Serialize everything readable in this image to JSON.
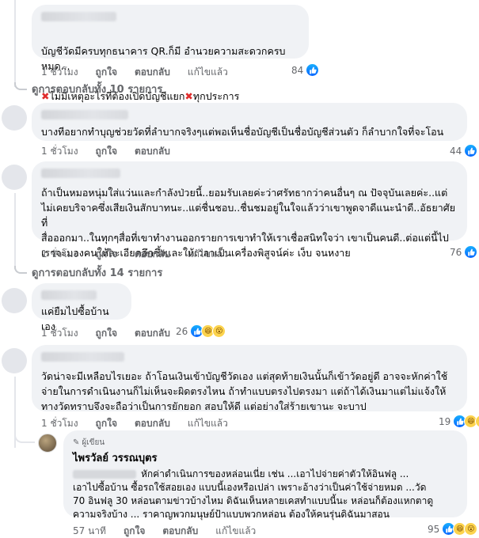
{
  "comments": [
    {
      "text_line1": "บัญชีวัดมีครบทุกธนาคาร QR.ก็มี อำนวยความสะดวกครบหมด...",
      "text_line2": "ไม่มีเหตุอะไรที่ต้องเปิดบัญชีแยก",
      "text_line2_end": "ทุกประการ",
      "time": "1 ชั่วโมง",
      "like": "ถูกใจ",
      "reply": "ตอบกลับ",
      "edited": "แก้ไขแล้ว",
      "reactions": "84",
      "thread": "ดูการตอบกลับทั้ง 10 รายการ"
    },
    {
      "text": "บางทีอยากทำบุญช่วยวัดที่ลำบากจริงๆแต่พอเห็นชื่อบัญชีเป็นชื่อบัญชีส่วนตัว ก็ลำบากใจที่จะโอน",
      "time": "1 ชั่วโมง",
      "like": "ถูกใจ",
      "reply": "ตอบกลับ",
      "reactions": "44"
    },
    {
      "text": "ถ้าเป็นหมอหนุ่มใส่แว่นและกำลังป่วยนี้..ยอมรับเลยค่ะว่าศรัทธากว่าคนอื่นๆ ณ ปัจจุบันเลยค่ะ..แต่\nไม่เคยบริจาคซึ่งเสียเงินสักบาทนะ..แต่ชื่นชอบ..ชื่นชมอยู่ในใจแล้วว่าเขาพูดจาดีแนะนำดี..อัธยาศัยที่\nสื่อออกมา..ในทุกๆสื่อที่เขาทำงานออกรายการเขาทำให้เราเชื่อสนิทใจว่า เขาเป็นคนดี..ต่อแต่นี้ไป\nเราจะมองคนให้ละเอียดลึกซึ้งและให้เวลาเป็นเครื่องพิสูจน์ค่ะ เง็บ จนหงาย",
      "time": "1 ชั่วโมง",
      "like": "ถูกใจ",
      "reply": "ตอบกลับ",
      "edited": "แก้ไขแล้ว",
      "reactions": "76",
      "thread": "ดูการตอบกลับทั้ง 14 รายการ"
    },
    {
      "text": "แค่ยืมไปซื้อบ้านเอง",
      "time": "1 ชั่วโมง",
      "like": "ถูกใจ",
      "reply": "ตอบกลับ",
      "reactions": "26"
    },
    {
      "text": "วัดน่าจะมีเหลือบไรเยอะ ถ้าโอนเงินเข้าบัญชีวัดเอง แต่สุดท้ายเงินนั้นก็เข้าวัดอยู่ดี อาจจะหักค่าใช้\nจ่ายในการดำเนินงานก็ไม่เห็นจะผิดตรงไหน ถ้าทำแบบตรงไปตรงมา แต่ถ้าได้เงินมาแต่ไม่แจ้งให้\nทางวัดทราบจึงจะถือว่าเป็นการยักยอก สอบให้ดี แต่อย่างใส่ร้ายเขานะ จะบาป",
      "time": "1 ชั่วโมง",
      "like": "ถูกใจ",
      "reply": "ตอบกลับ",
      "edited": "แก้ไขแล้ว",
      "reactions": "19"
    }
  ],
  "reply": {
    "badge": "ผู้เขียน",
    "author": "ไพรวัลย์ วรรณบุตร",
    "text": "หักค่าดำเนินการของหล่อนเนี่ย เช่น ...เอาไปจ่ายค่าตัวให้อินฟลู ...\nเอาไปซื้อบ้าน ซื้อรถใช้สอยเอง แบบนี้เองหรือเปล่า เพราะอ้างว่าเป็นค่าใช้จ่ายหมด ...วัด\n70 อินฟลู 30 หล่อนตามข่าวบ้างไหม ดิฉันเห็นหลายเคสทำแบบนี้นะ หล่อนก็ต้องแหกตาดู\nความจริงบ้าง ... ราคาญพวกมนุษย์ป้าแบบพวกหล่อน ต้องให้คนรุ่นดิฉันมาสอน",
    "time": "57 นาที",
    "like": "ถูกใจ",
    "reply": "ตอบกลับ",
    "edited": "แก้ไขแล้ว",
    "reactions": "95"
  },
  "icons": {
    "like": "like-thumb-icon",
    "haha": "haha-emoji-icon",
    "wow": "wow-emoji-icon",
    "x": "red-x-icon"
  },
  "colors": {
    "bubble": "#f0f2f5",
    "like_blue": "#0866ff",
    "meta_gray": "#65676b"
  }
}
